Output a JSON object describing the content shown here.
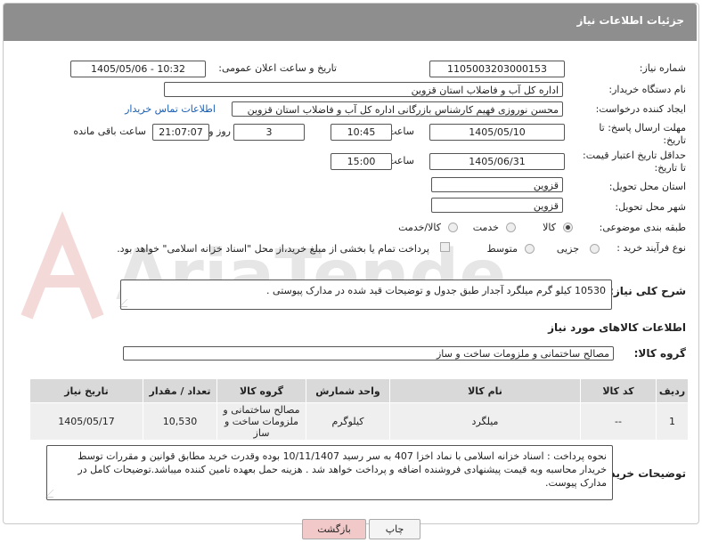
{
  "header": {
    "title": "جزئیات اطلاعات نیاز"
  },
  "fields": {
    "need_number_label": "شماره نیاز:",
    "need_number": "1105003203000153",
    "announce_label": "تاریخ و ساعت اعلان عمومی:",
    "announce_value": "1405/05/06 - 10:32",
    "buyer_label": "نام دستگاه خریدار:",
    "buyer_value": "اداره کل آب و فاضلاب استان قزوین",
    "creator_label": "ایجاد کننده درخواست:",
    "creator_value": "محسن نوروزی فهیم کارشناس بازرگانی اداره کل آب و فاضلاب استان قزوین",
    "contact_link": "اطلاعات تماس خریدار",
    "deadline_label_1": "مهلت ارسال پاسخ: تا",
    "deadline_label_2": "تاریخ:",
    "deadline_date": "1405/05/10",
    "time_word": "ساعت",
    "deadline_time": "10:45",
    "days_value": "3",
    "days_word": "روز و",
    "remaining_time": "21:07:07",
    "remaining_word": "ساعت باقی مانده",
    "validity_label_1": "حداقل تاریخ اعتبار قیمت:",
    "validity_label_2": "تا تاریخ:",
    "validity_date": "1405/06/31",
    "validity_time": "15:00",
    "province_label": "استان محل تحویل:",
    "province_value": "قزوین",
    "city_label": "شهر محل تحویل:",
    "city_value": "قزوین",
    "category_label": "طبقه بندی موضوعی:",
    "category_options": [
      "کالا",
      "خدمت",
      "کالا/خدمت"
    ],
    "category_selected": "کالا",
    "process_label": "نوع فرآیند خرید :",
    "process_options": [
      "جزیی",
      "متوسط"
    ],
    "process_selected": "متوسط",
    "payment_note": "پرداخت تمام یا بخشی از مبلغ خرید،از محل \"اسناد خزانه اسلامی\" خواهد بود."
  },
  "description": {
    "label": "شرح کلی نیاز:",
    "text": "10530 کیلو گرم میلگرد آجدار طبق جدول و توضیحات قید شده در مدارک پیوستی ."
  },
  "goods": {
    "section_title": "اطلاعات کالاهای مورد نیاز",
    "group_label": "گروه کالا:",
    "group_value": "مصالح ساختمانی و ملزومات ساخت و ساز",
    "columns": [
      "ردیف",
      "کد کالا",
      "نام کالا",
      "واحد شمارش",
      "گروه کالا",
      "تعداد / مقدار",
      "تاریخ نیاز"
    ],
    "rows": [
      {
        "row": "1",
        "code": "--",
        "name": "میلگرد",
        "unit": "کیلوگرم",
        "group": "مصالح ساختمانی و ملزومات ساخت و ساز",
        "qty": "10,530",
        "date": "1405/05/17"
      }
    ]
  },
  "buyer_notes": {
    "label": "توضیحات خریدار:",
    "text": "نحوه پرداخت : اسناد خزانه اسلامی با نماد اخزا 407 به سر رسید 10/11/1407 بوده وقدرت خرید مطابق قوانین و مقررات توسط خریدار محاسبه وبه قیمت پیشنهادی فروشنده اضافه و پرداخت خواهد شد . هزینه حمل بعهده تامین کننده میباشد.توضیحات کامل در مدارک پیوست."
  },
  "buttons": {
    "print": "چاپ",
    "back": "بازگشت"
  },
  "watermark": {
    "text": "AriaTender.net"
  },
  "colors": {
    "header_bg": "#8e8e8e",
    "link": "#1a5fb4",
    "back_button": "#f2c9c9",
    "table_header": "#d9d9d9",
    "table_cell": "#efefef"
  }
}
